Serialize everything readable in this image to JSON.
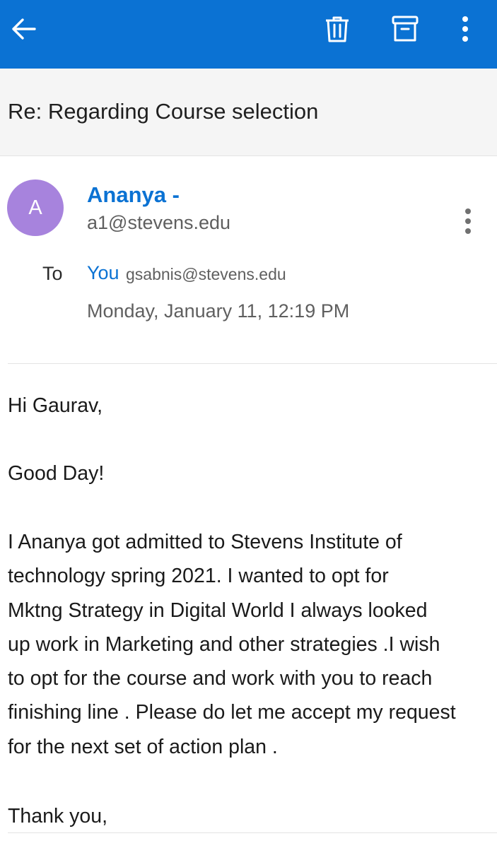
{
  "toolbar": {
    "background": "#0b72d3",
    "back_icon": "arrow-left-icon",
    "delete_icon": "trash-icon",
    "archive_icon": "archive-icon",
    "more_icon": "more-vertical-icon"
  },
  "subject": "Re: Regarding Course selection",
  "sender": {
    "avatar_initial": "A",
    "avatar_color": "#a783dd",
    "name": "Ananya -",
    "email": "a1@stevens.edu"
  },
  "recipients": {
    "to_label": "To",
    "you_label": "You",
    "you_email": "gsabnis@stevens.edu"
  },
  "date": "Monday, January 11, 12:19 PM",
  "body": {
    "greeting": "Hi Gaurav,",
    "line2": "Good Day!",
    "paragraph_lines": [
      "I Ananya got admitted to Stevens Institute of",
      "technology spring 2021. I wanted to opt for",
      "Mktng Strategy in Digital World  I always looked",
      "up work in Marketing and other strategies .I wish",
      "to opt for the course and work with you to reach",
      "finishing line . Please do let me accept my request",
      "for the next set of action plan ."
    ],
    "closing": "Thank you,"
  }
}
